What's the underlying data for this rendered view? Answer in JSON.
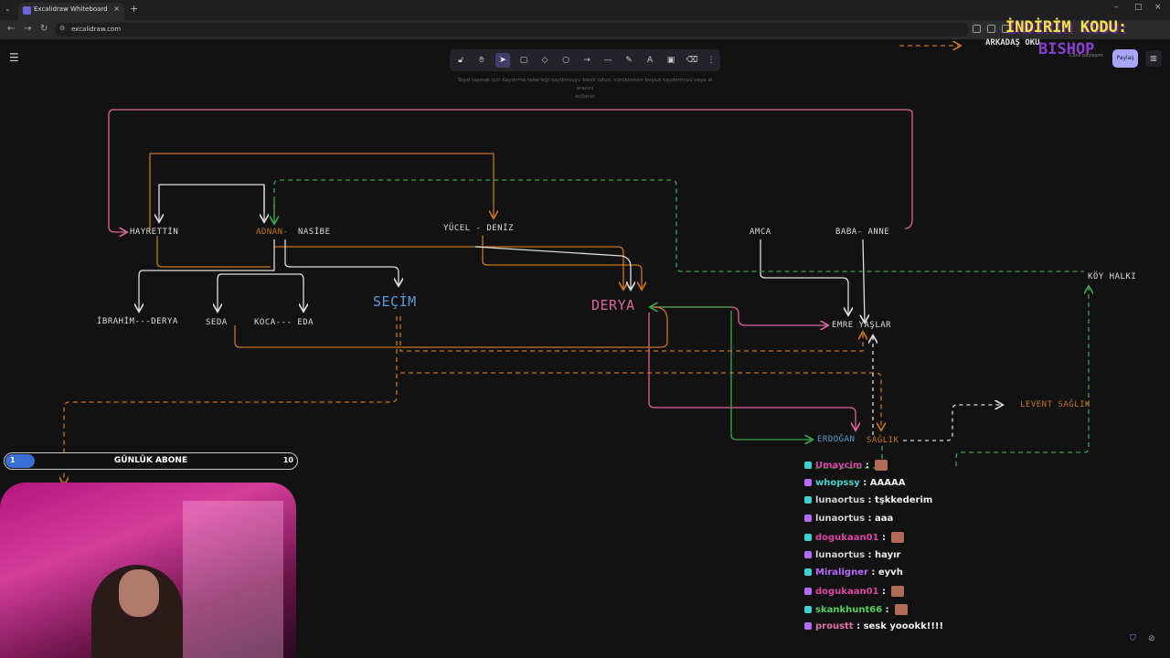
{
  "browser": {
    "tab_title": "Excalidraw Whiteboard",
    "url": "excalidraw.com",
    "new_tab": "+",
    "close": "×",
    "minimize": "–",
    "maximize": "□"
  },
  "excalidraw": {
    "toolbar": {
      "tools": [
        "lock-icon",
        "hand-icon",
        "selection-icon",
        "rectangle-icon",
        "diamond-icon",
        "ellipse-icon",
        "arrow-icon",
        "line-icon",
        "draw-icon",
        "text-icon",
        "image-icon",
        "eraser-icon",
        "more-icon"
      ],
      "active": "selection-icon"
    },
    "hint_line1": "Taşıd taşmak için  Kaydırma tekerleği  kaydırmuyu basılı tutun, sürüklerken  boşluk  kaydırmuyu veya el aracını",
    "hint_line2": "kullanın",
    "share_label": "Paylaş",
    "session_label": "Canlı paylaşım",
    "diagram": {
      "nodes": {
        "hayrettin": "HAYRETTİN",
        "adnan": "ADNAN-",
        "nasibe": "NASİBE",
        "yucel_deniz": "YÜCEL - DENİZ",
        "amca": "AMCA",
        "baba_anne": "BABA- ANNE",
        "koy_halki": "KÖY HALKI",
        "ibrahim_derya": "İBRAHİM---DERYA",
        "seda": "SEDA",
        "koca_eda": "KOCA--- EDA",
        "secim": "SEÇİM",
        "derya": "DERYA",
        "emre_yaslar": "EMRE YAŞLAR",
        "levent_saglik": "LEVENT SAĞLIK",
        "erdogan": "ERDOĞAN",
        "saglik": "SAĞLIK"
      },
      "colors": {
        "pink": "#e0649b",
        "orange": "#c8741f",
        "green": "#3fa34d",
        "white": "#dddddd",
        "blue": "#5b9bd5"
      }
    }
  },
  "overlay": {
    "promo_line1": "İNDİRİM KODU:",
    "promo_line2": "ARKADAŞ OKU",
    "promo_line3": "BISHOP",
    "sub_goal": {
      "label": "GÜNLÜK ABONE",
      "current": "1",
      "goal": "10",
      "progress": 0.1
    },
    "chat": [
      {
        "user": "Umaycim",
        "color": "#d946a8",
        "text": "",
        "emote": true
      },
      {
        "user": "whopssy",
        "color": "#3ad1d1",
        "text": "AAAAA",
        "emote": false
      },
      {
        "user": "lunaortus",
        "color": "#d0d0d0",
        "text": "tşkkederim",
        "emote": false
      },
      {
        "user": "lunaortus",
        "color": "#d0d0d0",
        "text": "aaa",
        "emote": false
      },
      {
        "user": "dogukaan01",
        "color": "#d946a8",
        "text": "",
        "emote": true
      },
      {
        "user": "lunaortus",
        "color": "#d0d0d0",
        "text": "hayır",
        "emote": false
      },
      {
        "user": "Miraligner",
        "color": "#b56bff",
        "text": "eyvh",
        "emote": false
      },
      {
        "user": "dogukaan01",
        "color": "#d946a8",
        "text": "",
        "emote": true
      },
      {
        "user": "skankhunt66",
        "color": "#4fd35a",
        "text": "",
        "emote": true
      },
      {
        "user": "proustt",
        "color": "#e06fa8",
        "text": "sesk yoookk!!!!",
        "emote": false
      }
    ]
  }
}
